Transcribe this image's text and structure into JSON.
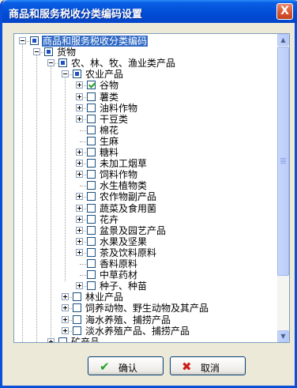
{
  "window": {
    "title": "商品和服务税收分类编码设置",
    "close_glyph": "X"
  },
  "tree": {
    "nodes": [
      {
        "label": "商品和服务税收分类编码",
        "state": "partial",
        "expander": "minus",
        "selected": true
      },
      {
        "label": "货物",
        "state": "partial",
        "expander": "minus"
      },
      {
        "label": "农、林、牧、渔业类产品",
        "state": "partial",
        "expander": "minus"
      },
      {
        "label": "农业产品",
        "state": "partial",
        "expander": "minus"
      },
      {
        "label": "谷物",
        "state": "checked",
        "expander": "plus"
      },
      {
        "label": "薯类",
        "state": "unchecked",
        "expander": "plus"
      },
      {
        "label": "油料作物",
        "state": "unchecked",
        "expander": "plus"
      },
      {
        "label": "干豆类",
        "state": "unchecked",
        "expander": "plus"
      },
      {
        "label": "棉花",
        "state": "unchecked",
        "expander": "none"
      },
      {
        "label": "生麻",
        "state": "unchecked",
        "expander": "none"
      },
      {
        "label": "糖料",
        "state": "unchecked",
        "expander": "plus"
      },
      {
        "label": "未加工烟草",
        "state": "unchecked",
        "expander": "plus"
      },
      {
        "label": "饲料作物",
        "state": "unchecked",
        "expander": "plus"
      },
      {
        "label": "水生植物类",
        "state": "unchecked",
        "expander": "none"
      },
      {
        "label": "农作物副产品",
        "state": "unchecked",
        "expander": "plus"
      },
      {
        "label": "蔬菜及食用菌",
        "state": "unchecked",
        "expander": "plus"
      },
      {
        "label": "花卉",
        "state": "unchecked",
        "expander": "plus"
      },
      {
        "label": "盆景及园艺产品",
        "state": "unchecked",
        "expander": "plus"
      },
      {
        "label": "水果及坚果",
        "state": "unchecked",
        "expander": "plus"
      },
      {
        "label": "茶及饮料原料",
        "state": "unchecked",
        "expander": "plus"
      },
      {
        "label": "香料原料",
        "state": "unchecked",
        "expander": "none"
      },
      {
        "label": "中草药材",
        "state": "unchecked",
        "expander": "none"
      },
      {
        "label": "种子、种苗",
        "state": "unchecked",
        "expander": "plus"
      },
      {
        "label": "林业产品",
        "state": "unchecked",
        "expander": "plus"
      },
      {
        "label": "饲养动物、野生动物及其产品",
        "state": "unchecked",
        "expander": "plus"
      },
      {
        "label": "海水养殖、捕捞产品",
        "state": "unchecked",
        "expander": "plus"
      },
      {
        "label": "淡水养殖产品、捕捞产品",
        "state": "unchecked",
        "expander": "plus"
      },
      {
        "label": "矿产品",
        "state": "unchecked",
        "expander": "plus"
      }
    ]
  },
  "buttons": {
    "ok_label": "确认",
    "cancel_label": "取消",
    "ok_icon": "checkmark-icon",
    "cancel_icon": "x-icon"
  },
  "colors": {
    "title_bar": "#0453DB",
    "selection": "#316AC5",
    "check_green": "#21A121",
    "cancel_red": "#CC1F1F"
  }
}
